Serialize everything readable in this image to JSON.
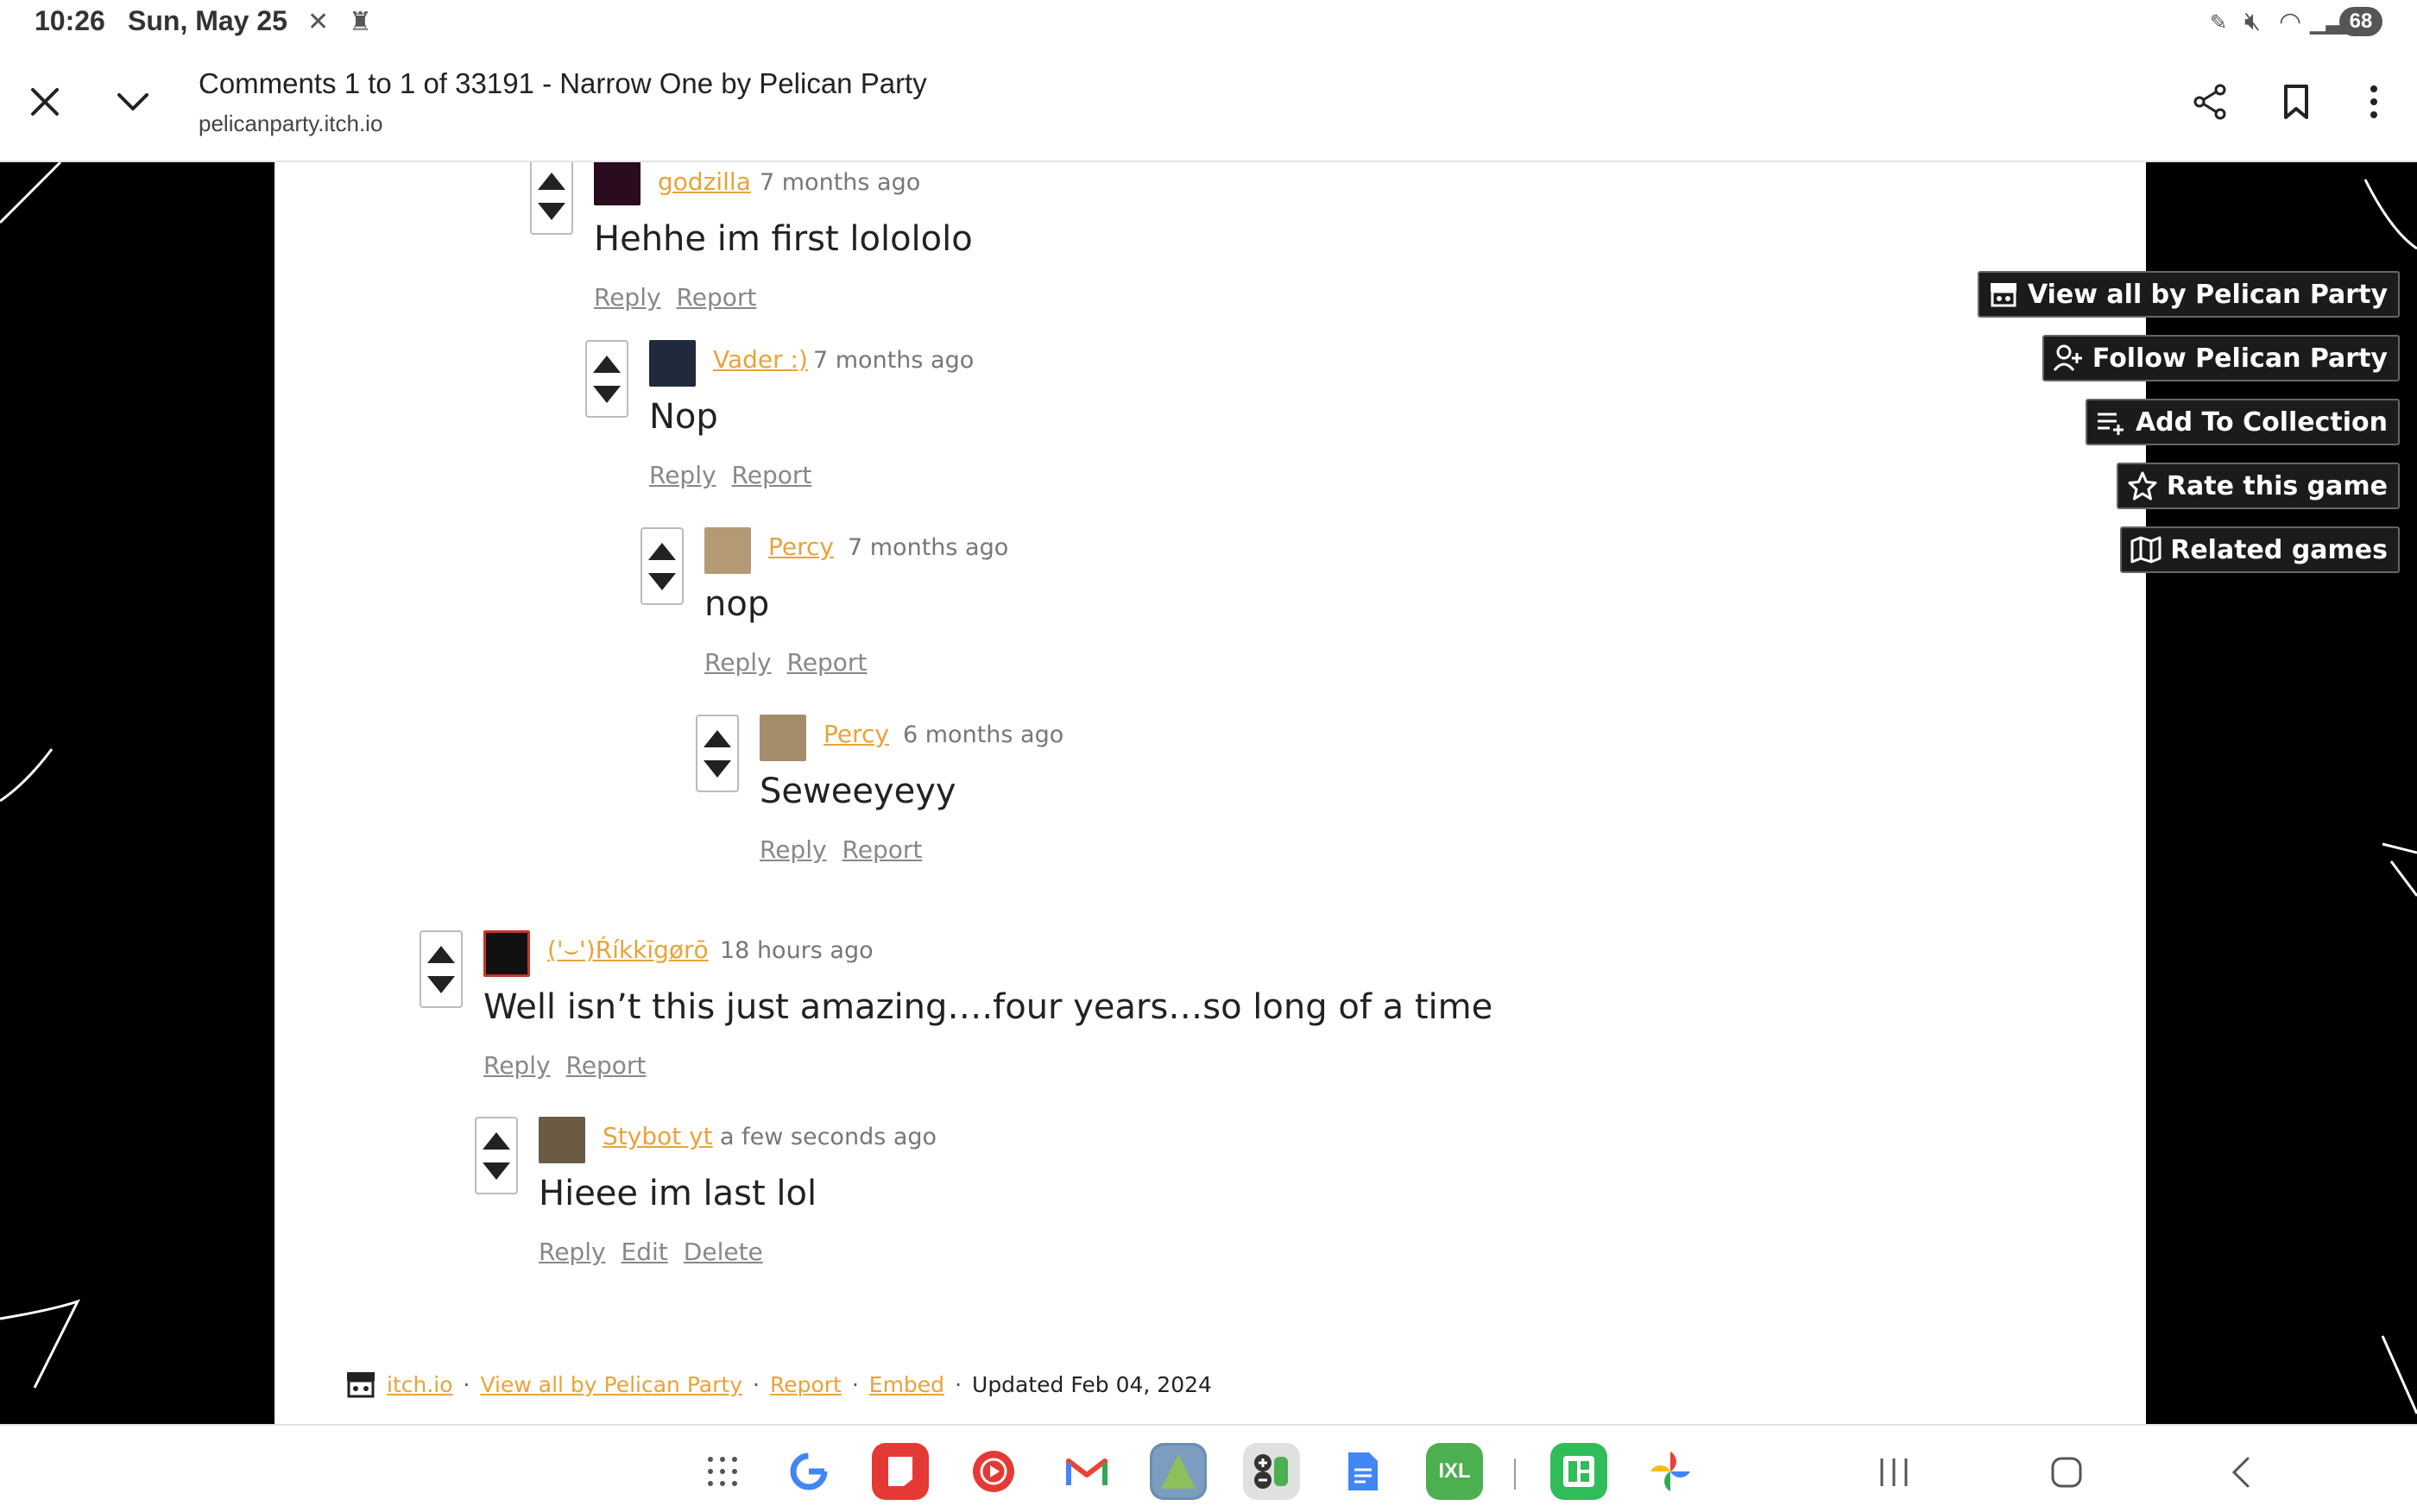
{
  "status_bar": {
    "time": "10:26",
    "date": "Sun, May 25",
    "battery": "68"
  },
  "toolbar": {
    "title": "Comments 1 to 1 of 33191 - Narrow One by Pelican Party",
    "url": "pelicanparty.itch.io"
  },
  "comments": [
    {
      "author": "godzilla",
      "time": "7 months ago",
      "body": "Hehhe im first lolololo",
      "actions": [
        "Reply",
        "Report"
      ]
    },
    {
      "author": "Vader :)",
      "time": "7 months ago",
      "body": "Nop",
      "actions": [
        "Reply",
        "Report"
      ]
    },
    {
      "author": "Percy",
      "time": "7 months ago",
      "body": "nop",
      "actions": [
        "Reply",
        "Report"
      ]
    },
    {
      "author": "Percy",
      "time": "6 months ago",
      "body": "Seweeyeyy",
      "actions": [
        "Reply",
        "Report"
      ]
    },
    {
      "author": "('⌣')Ŕíkkīgørō",
      "time": "18 hours ago",
      "body": "Well isn’t this just amazing….four years…so long of a time",
      "actions": [
        "Reply",
        "Report"
      ]
    },
    {
      "author": "Stybot yt",
      "time": "a few seconds ago",
      "body": "Hieee im last lol",
      "actions": [
        "Reply",
        "Edit",
        "Delete"
      ]
    }
  ],
  "sidebar": {
    "view_all": "View all by Pelican Party",
    "follow": "Follow Pelican Party",
    "add_collection": "Add To Collection",
    "rate": "Rate this game",
    "related": "Related games"
  },
  "footer": {
    "itchio": "itch.io",
    "view_all": "View all by Pelican Party",
    "report": "Report",
    "embed": "Embed",
    "updated": "Updated Feb 04, 2024"
  },
  "colors": {
    "author_link": "#e8a33a",
    "background": "#000000",
    "panel": "#ffffff"
  }
}
